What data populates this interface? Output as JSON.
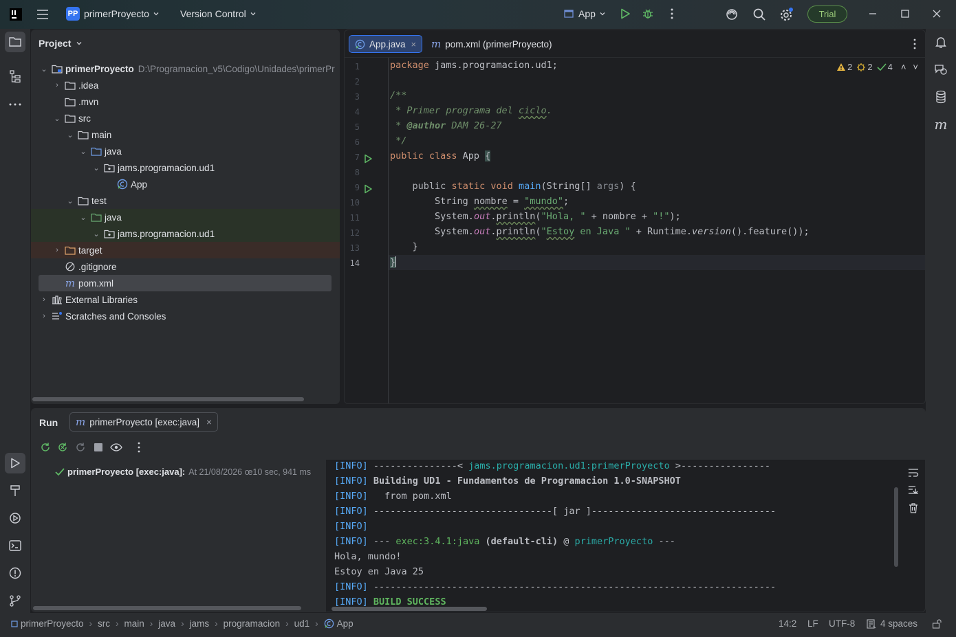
{
  "titlebar": {
    "project_badge": "PP",
    "project_name": "primerProyecto",
    "vcs_label": "Version Control",
    "run_config": "App",
    "trial_label": "Trial"
  },
  "project_panel": {
    "title": "Project",
    "root_name": "primerProyecto",
    "root_path": "D:\\Programacion_v5\\Codigo\\Unidades\\primerPr",
    "items": [
      {
        "label": ".idea"
      },
      {
        "label": ".mvn"
      },
      {
        "label": "src"
      },
      {
        "label": "main"
      },
      {
        "label": "java"
      },
      {
        "label": "jams.programacion.ud1"
      },
      {
        "label": "App"
      },
      {
        "label": "test"
      },
      {
        "label": "java"
      },
      {
        "label": "jams.programacion.ud1"
      },
      {
        "label": "target"
      },
      {
        "label": ".gitignore"
      },
      {
        "label": "pom.xml"
      },
      {
        "label": "External Libraries"
      },
      {
        "label": "Scratches and Consoles"
      }
    ]
  },
  "editor": {
    "tabs": [
      {
        "label": "App.java"
      },
      {
        "label": "pom.xml (primerProyecto)"
      }
    ],
    "inspections": {
      "warnings": "2",
      "weak": "2",
      "ok": "4"
    },
    "line_numbers": [
      "1",
      "2",
      "3",
      "4",
      "5",
      "6",
      "7",
      "8",
      "9",
      "10",
      "11",
      "12",
      "13",
      "14"
    ],
    "code": {
      "l1_kw": "package",
      "l1_rest": " jams.programacion.ud1;",
      "l3": "/**",
      "l4_a": " * Primer programa del ",
      "l4_b": "ciclo",
      "l4_c": ".",
      "l5_a": " * ",
      "l5_tag": "@author",
      "l5_b": " DAM 26-27",
      "l6": " */",
      "l7_kw": "public class",
      "l7_rest": " App ",
      "l7_brace": "{",
      "l9_kw1": "public",
      "l9_kw2": "static void",
      "l9_fn": "main",
      "l9_rest": "(String[] ",
      "l9_param": "args",
      "l9_end": ") {",
      "l10_a": "String ",
      "l10_var": "nombre",
      "l10_b": " = ",
      "l10_str": "\"mundo\"",
      "l10_c": ";",
      "l11_a": "System.",
      "l11_out": "out",
      "l11_b": ".",
      "l11_fn": "println",
      "l11_c": "(",
      "l11_str": "\"Hola, \"",
      "l11_d": " + nombre + ",
      "l11_str2": "\"!\"",
      "l11_e": ");",
      "l12_a": "System.",
      "l12_out": "out",
      "l12_b": ".",
      "l12_fn": "println",
      "l12_c": "(",
      "l12_str_a": "\"",
      "l12_str_b": "Estoy",
      "l12_str_c": " en Java \"",
      "l12_d": " + Runtime.",
      "l12_ver": "version",
      "l12_e": "().feature());",
      "l13": "}",
      "l14": "}"
    }
  },
  "run_panel": {
    "title": "Run",
    "tab_label": "primerProyecto [exec:java]",
    "tree_item_name": "primerProyecto [exec:java]:",
    "tree_item_time": "At 21/08/2026 œ10 sec, 941 ms",
    "console": {
      "tag": "[INFO]",
      "l1_a": " ---------------< ",
      "l1_b": "jams.programacion.ud1:primerProyecto",
      "l1_c": " >----------------",
      "l2": " Building UD1 - Fundamentos de Programacion 1.0-SNAPSHOT",
      "l3": "   from pom.xml",
      "l4": " --------------------------------[ jar ]---------------------------------",
      "l6_a": " --- ",
      "l6_b": "exec:3.4.1:java",
      "l6_c": " (default-cli)",
      "l6_d": " @ ",
      "l6_e": "primerProyecto",
      "l6_f": " ---",
      "out1": "Hola, mundo!",
      "out2": "Estoy en Java 25",
      "l9": " ------------------------------------------------------------------------",
      "l10": " BUILD SUCCESS"
    }
  },
  "statusbar": {
    "breadcrumbs": [
      "primerProyecto",
      "src",
      "main",
      "java",
      "jams",
      "programacion",
      "ud1",
      "App"
    ],
    "position": "14:2",
    "line_sep": "LF",
    "encoding": "UTF-8",
    "indent": "4 spaces"
  }
}
